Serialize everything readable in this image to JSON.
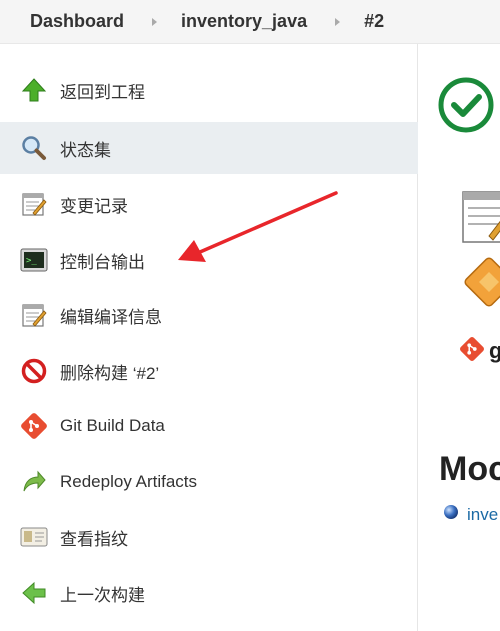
{
  "breadcrumb": {
    "items": [
      "Dashboard",
      "inventory_java",
      "#2"
    ]
  },
  "sidebar": {
    "items": [
      {
        "label": "返回到工程",
        "icon": "up-arrow-icon"
      },
      {
        "label": "状态集",
        "icon": "magnifier-icon"
      },
      {
        "label": "变更记录",
        "icon": "notepad-icon"
      },
      {
        "label": "控制台输出",
        "icon": "terminal-icon"
      },
      {
        "label": "编辑编译信息",
        "icon": "notepad-icon"
      },
      {
        "label": "删除构建 ‘#2’",
        "icon": "no-entry-icon"
      },
      {
        "label": "Git Build Data",
        "icon": "git-icon"
      },
      {
        "label": "Redeploy Artifacts",
        "icon": "redeploy-icon"
      },
      {
        "label": "查看指纹",
        "icon": "fingerprint-icon"
      },
      {
        "label": "上一次构建",
        "icon": "left-arrow-icon"
      }
    ]
  },
  "main": {
    "status_icon": "success-check-icon",
    "heading_fragment": "Moc",
    "git_fragment": "g",
    "link_fragment": "inve"
  },
  "colors": {
    "success": "#1a8a3a",
    "link": "#1b6aa5",
    "annotation_arrow": "#e8262b",
    "active_row": "#eaeef1"
  }
}
